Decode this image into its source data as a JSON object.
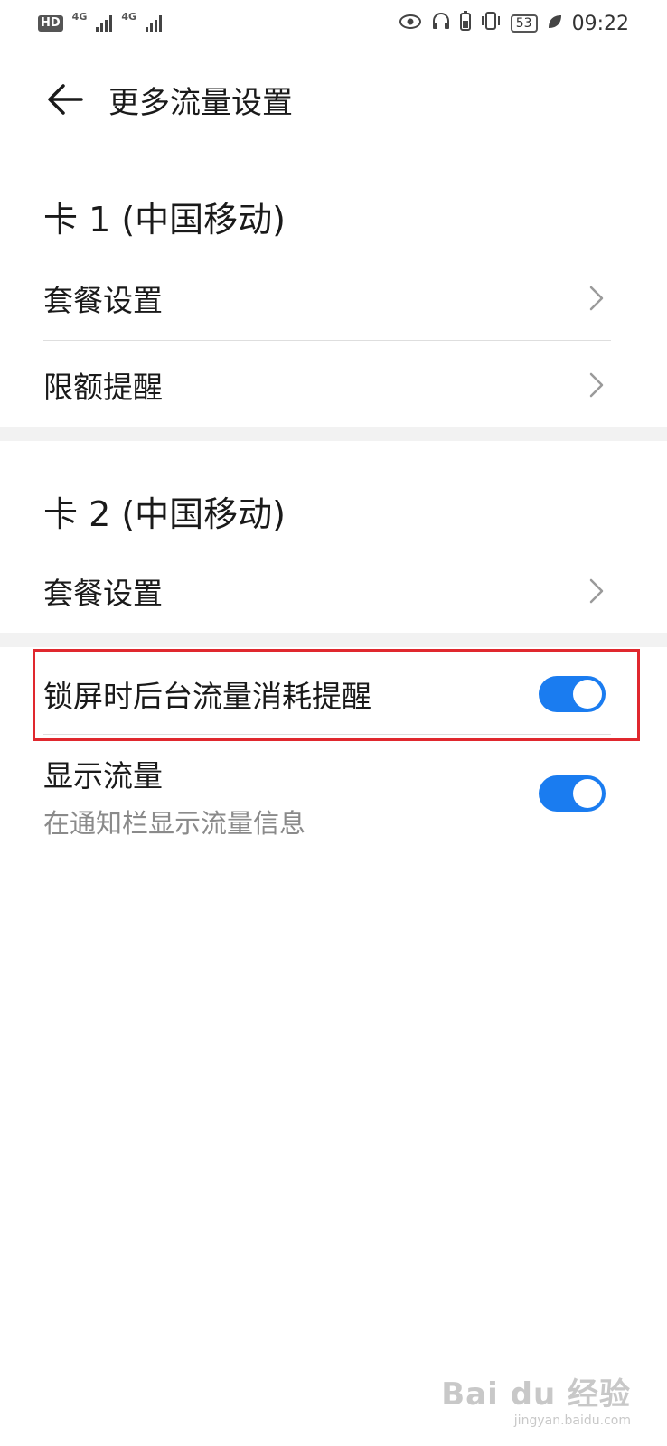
{
  "status_bar": {
    "hd": "HD",
    "net1": "4G",
    "net2": "4G",
    "battery": "53",
    "time": "09:22"
  },
  "header": {
    "title": "更多流量设置"
  },
  "sim1": {
    "title": "卡 1 (中国移动)",
    "items": [
      {
        "label": "套餐设置"
      },
      {
        "label": "限额提醒"
      }
    ]
  },
  "sim2": {
    "title": "卡 2 (中国移动)",
    "items": [
      {
        "label": "套餐设置"
      }
    ]
  },
  "toggles": [
    {
      "label": "锁屏时后台流量消耗提醒",
      "on": true
    },
    {
      "label": "显示流量",
      "sublabel": "在通知栏显示流量信息",
      "on": true
    }
  ],
  "watermark": {
    "main": "Bai du 经验",
    "sub": "jingyan.baidu.com"
  },
  "colors": {
    "accent": "#1a7cf0",
    "highlight": "#e0282e"
  }
}
